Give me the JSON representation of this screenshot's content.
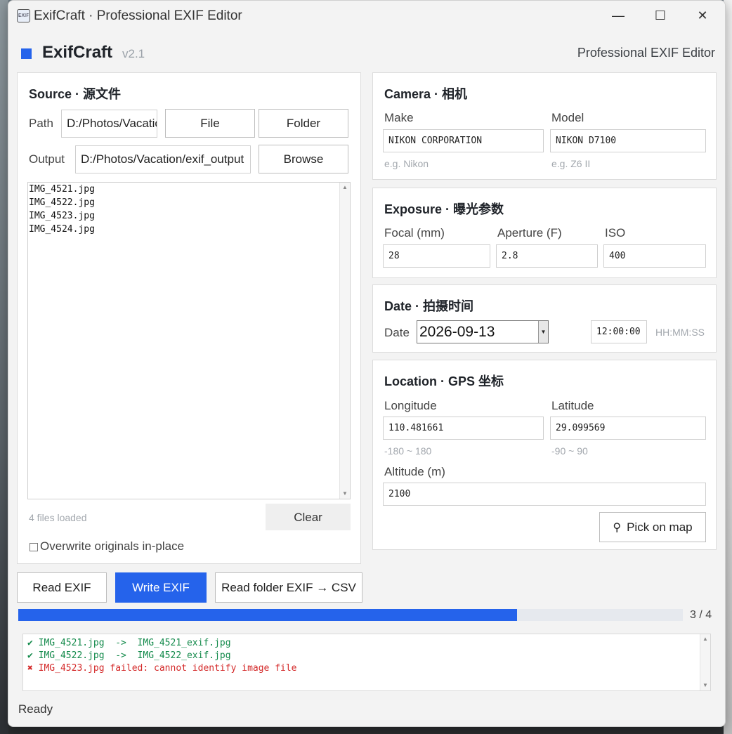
{
  "window": {
    "title": "ExifCraft  ·  Professional EXIF Editor",
    "icon_text": "EXIF",
    "controls": {
      "minimize": "—",
      "maximize": "☐",
      "close": "✕"
    }
  },
  "brand": {
    "name": "ExifCraft",
    "version": "v2.1",
    "subtitle": "Professional EXIF Editor",
    "accent": "#2563eb"
  },
  "source": {
    "title": "Source  ·  源文件",
    "path_label": "Path",
    "path_value": "D:/Photos/Vacation",
    "file_button": "File",
    "folder_button": "Folder",
    "output_label": "Output",
    "output_value": "D:/Photos/Vacation/exif_output",
    "browse_button": "Browse",
    "files": [
      "IMG_4521.jpg",
      "IMG_4522.jpg",
      "IMG_4523.jpg",
      "IMG_4524.jpg"
    ],
    "files_loaded": "4 files loaded",
    "clear_button": "Clear",
    "overwrite_label": "Overwrite originals in-place"
  },
  "camera": {
    "title": "Camera  ·  相机",
    "make_label": "Make",
    "make_value": "NIKON CORPORATION",
    "make_hint": "e.g. Nikon",
    "model_label": "Model",
    "model_value": "NIKON D7100",
    "model_hint": "e.g. Z6 II"
  },
  "exposure": {
    "title": "Exposure  ·  曝光参数",
    "focal_label": "Focal (mm)",
    "focal_value": "28",
    "aperture_label": "Aperture (F)",
    "aperture_value": "2.8",
    "iso_label": "ISO",
    "iso_value": "400"
  },
  "date": {
    "title": "Date  ·  拍摄时间",
    "date_label": "Date",
    "date_value": "2026-09-13",
    "time_value": "12:00:00",
    "time_hint": "HH:MM:SS"
  },
  "location": {
    "title": "Location  ·  GPS 坐标",
    "longitude_label": "Longitude",
    "longitude_value": "110.481661",
    "longitude_hint": "-180 ~ 180",
    "latitude_label": "Latitude",
    "latitude_value": "29.099569",
    "latitude_hint": "-90 ~ 90",
    "altitude_label": "Altitude (m)",
    "altitude_value": "2100",
    "pick_map_button": "Pick on map"
  },
  "actions": {
    "read_exif": "Read EXIF",
    "write_exif": "Write EXIF",
    "read_folder_csv": "Read folder EXIF → CSV"
  },
  "progress": {
    "done": 3,
    "total": 4,
    "text": "3 / 4"
  },
  "log": [
    {
      "icon": "✔",
      "text": "IMG_4521.jpg  ->  IMG_4521_exif.jpg",
      "color": "#138a4b"
    },
    {
      "icon": "✔",
      "text": "IMG_4522.jpg  ->  IMG_4522_exif.jpg",
      "color": "#138a4b"
    },
    {
      "icon": "✖",
      "text": "IMG_4523.jpg failed: cannot identify image file",
      "color": "#d42a2a"
    }
  ],
  "status": "Ready"
}
